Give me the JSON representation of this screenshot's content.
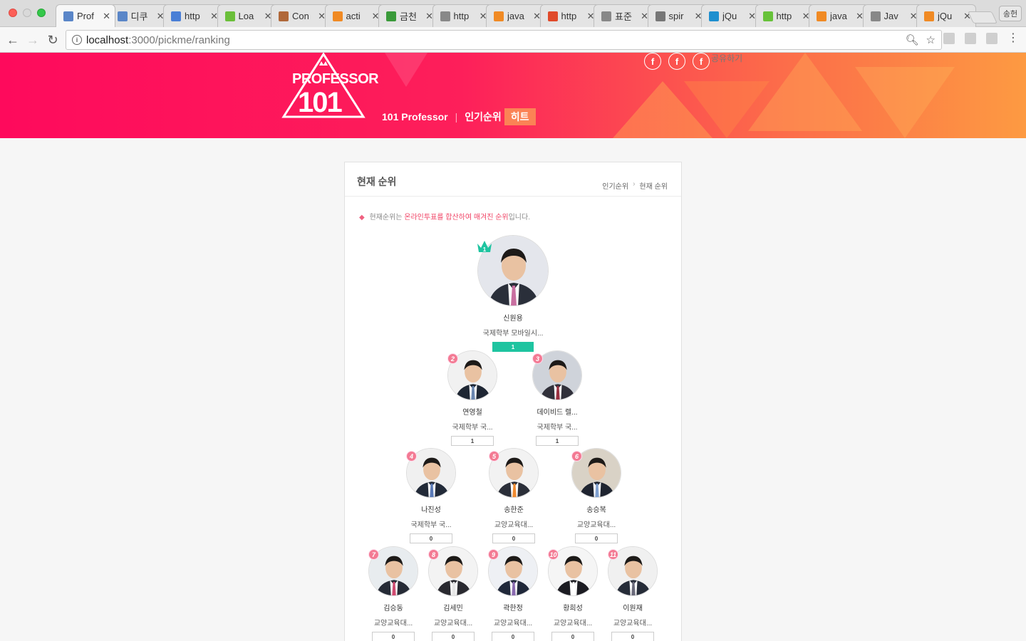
{
  "browser": {
    "tabs": [
      {
        "title": "Prof",
        "color": "#5a86c8",
        "active": true
      },
      {
        "title": "디쿠",
        "color": "#5a86c8"
      },
      {
        "title": "http",
        "color": "#4a7fd6"
      },
      {
        "title": "Loa",
        "color": "#6bbf3a"
      },
      {
        "title": "Con",
        "color": "#b0683a"
      },
      {
        "title": "acti",
        "color": "#f08a24"
      },
      {
        "title": "금천",
        "color": "#3a9a3a"
      },
      {
        "title": "http",
        "color": "#888888"
      },
      {
        "title": "java",
        "color": "#f08a24"
      },
      {
        "title": "http",
        "color": "#e04a2a"
      },
      {
        "title": "표준",
        "color": "#888888"
      },
      {
        "title": "spir",
        "color": "#777777"
      },
      {
        "title": "jQu",
        "color": "#1e8fcf"
      },
      {
        "title": "http",
        "color": "#67c23a"
      },
      {
        "title": "java",
        "color": "#f08a24"
      },
      {
        "title": "Jav",
        "color": "#888888"
      },
      {
        "title": "jQu",
        "color": "#f08a24"
      }
    ],
    "profile_label": "송헌",
    "url_host": "localhost",
    "url_path": ":3000/pickme/ranking"
  },
  "header": {
    "logo_line1": "PROFESSOR",
    "logo_line2": "101",
    "nav": [
      "101 Professor",
      "인기순위",
      "히트"
    ],
    "share_label": "공유하기",
    "social_icon": "f",
    "colors": {
      "brand_pink": "#fe0a5c",
      "brand_orange": "#fd9a42"
    }
  },
  "ranking": {
    "title": "현재 순위",
    "breadcrumb": [
      "인기순위",
      "현재 순위"
    ],
    "notice_prefix": "현재순위는 ",
    "notice_highlight": "온라인투표를 합산하여 매겨진 순위",
    "notice_suffix": "입니다.",
    "professors": [
      {
        "rank": "1",
        "name": "신원용",
        "affiliation": "국제학부 모바일시...",
        "votes": "1"
      },
      {
        "rank": "2",
        "name": "연영철",
        "affiliation": "국제학부 국...",
        "votes": "1"
      },
      {
        "rank": "3",
        "name": "데이비드 렐...",
        "affiliation": "국제학부 국...",
        "votes": "1"
      },
      {
        "rank": "4",
        "name": "나진성",
        "affiliation": "국제학부 국...",
        "votes": "0"
      },
      {
        "rank": "5",
        "name": "송한준",
        "affiliation": "교양교육대...",
        "votes": "0"
      },
      {
        "rank": "6",
        "name": "송승복",
        "affiliation": "교양교육대...",
        "votes": "0"
      },
      {
        "rank": "7",
        "name": "김승동",
        "affiliation": "교양교육대...",
        "votes": "0"
      },
      {
        "rank": "8",
        "name": "김세민",
        "affiliation": "교양교육대...",
        "votes": "0"
      },
      {
        "rank": "9",
        "name": "곽한정",
        "affiliation": "교양교육대...",
        "votes": "0"
      },
      {
        "rank": "10",
        "name": "황희성",
        "affiliation": "교양교육대...",
        "votes": "0"
      },
      {
        "rank": "11",
        "name": "이원재",
        "affiliation": "교양교육대...",
        "votes": "0"
      }
    ]
  }
}
